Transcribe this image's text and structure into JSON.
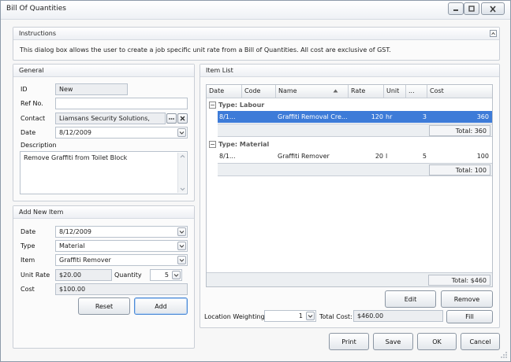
{
  "window": {
    "title": "Bill Of Quantities"
  },
  "instructions": {
    "heading": "Instructions",
    "text": "This dialog box allows the user to create a job specific unit rate from a Bill of Quantities. All cost are exclusive of GST."
  },
  "general": {
    "heading": "General",
    "id_label": "ID",
    "id_value": "New",
    "ref_label": "Ref No.",
    "ref_value": "",
    "contact_label": "Contact",
    "contact_value": "Liamsans Security Solutions,",
    "date_label": "Date",
    "date_value": "8/12/2009",
    "description_label": "Description",
    "description_value": "Remove Graffiti from Toilet Block"
  },
  "add_item": {
    "heading": "Add New Item",
    "date_label": "Date",
    "date_value": "8/12/2009",
    "type_label": "Type",
    "type_value": "Material",
    "item_label": "Item",
    "item_value": "Graffiti Remover",
    "unit_rate_label": "Unit Rate",
    "unit_rate_value": "$20.00",
    "quantity_label": "Quantity",
    "quantity_value": "5",
    "cost_label": "Cost",
    "cost_value": "$100.00",
    "reset_label": "Reset",
    "add_label": "Add"
  },
  "item_list": {
    "heading": "Item List",
    "columns": [
      "Date",
      "Code",
      "Name",
      "Rate",
      "Unit",
      "...",
      "Cost"
    ],
    "groups": [
      {
        "label": "Type: Labour",
        "rows": [
          {
            "date": "8/1...",
            "code": "",
            "name": "Graffiti Removal Cre...",
            "rate": "120",
            "unit": "hr",
            "qty": "3",
            "cost": "360"
          }
        ],
        "total": "Total:  360"
      },
      {
        "label": "Type: Material",
        "rows": [
          {
            "date": "8/1...",
            "code": "",
            "name": "Graffiti Remover",
            "rate": "20",
            "unit": "l",
            "qty": "5",
            "cost": "100"
          }
        ],
        "total": "Total:  100"
      }
    ],
    "grand_total": "Total: $460",
    "edit_label": "Edit",
    "remove_label": "Remove",
    "location_weighting_label": "Location Weighting",
    "location_weighting_value": "1",
    "total_cost_label": "Total Cost:",
    "total_cost_value": "$460.00",
    "fill_label": "Fill"
  },
  "footer": {
    "print_label": "Print",
    "save_label": "Save",
    "ok_label": "OK",
    "cancel_label": "Cancel"
  },
  "colors": {
    "selection": "#3d7bd8",
    "panel_border": "#c9ced6",
    "button_focus": "#4c8ad6"
  }
}
